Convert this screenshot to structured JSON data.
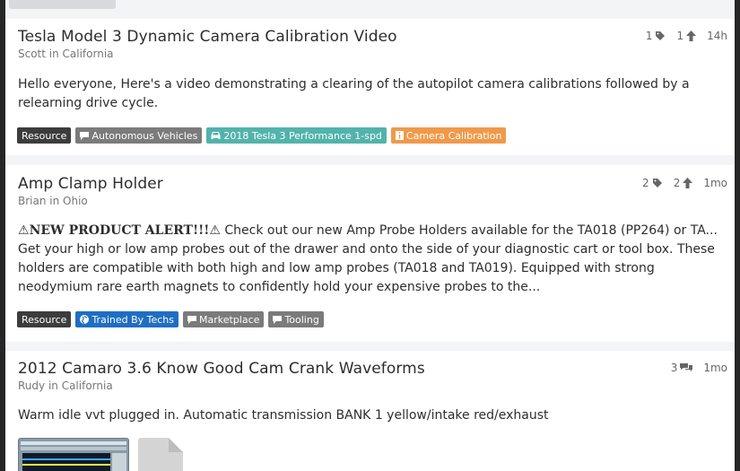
{
  "top_button": {
    "label": ""
  },
  "posts": [
    {
      "title": "Tesla Model 3 Dynamic Camera Calibration Video",
      "author": "Scott in California",
      "meta": {
        "tags_count": "1",
        "votes": "1",
        "age": "14h"
      },
      "body": "Hello everyone, Here's a video demonstrating a clearing of the autopilot camera calibrations followed by a relearning drive cycle.",
      "tags": [
        {
          "label": "Resource",
          "color": "#3c3c3c",
          "icon": ""
        },
        {
          "label": "Autonomous Vehicles",
          "color": "#7b7b7b",
          "icon": "chat-icon"
        },
        {
          "label": "2018 Tesla 3 Performance 1-spd",
          "color": "#52b3ab",
          "icon": "car-icon"
        },
        {
          "label": "Camera Calibration",
          "color": "#f0994a",
          "icon": "info-icon"
        }
      ]
    },
    {
      "title": "Amp Clamp Holder",
      "author": "Brian in Ohio",
      "meta": {
        "tags_count": "2",
        "votes": "2",
        "age": "1mo"
      },
      "body_prefix": "⚠",
      "body_bold": "NEW PRODUCT ALERT!!!",
      "body": "⚠ Check out our new Amp Probe Holders available for the TA018 (PP264) or TA... Get your high or low amp probes out of the drawer and onto the side of your diagnostic cart or tool box. These holders are compatible with both high and low amp probes (TA018 and TA019). Equipped with strong neodymium rare earth magnets to confidently hold your expensive probes to the...",
      "tags": [
        {
          "label": "Resource",
          "color": "#3c3c3c",
          "icon": ""
        },
        {
          "label": "Trained By Techs",
          "color": "#1f6ec2",
          "icon": "globe-icon"
        },
        {
          "label": "Marketplace",
          "color": "#7b7b7b",
          "icon": "chat-icon"
        },
        {
          "label": "Tooling",
          "color": "#7b7b7b",
          "icon": "chat-icon"
        }
      ]
    },
    {
      "title": "2012 Camaro 3.6 Know Good Cam Crank Waveforms",
      "author": "Rudy in California",
      "meta": {
        "comments": "3",
        "age": "1mo"
      },
      "body": "Warm idle vvt plugged in. Automatic transmission BANK 1 yellow/intake red/exhaust"
    }
  ],
  "colors": {
    "card_bg": "#ffffff",
    "page_bg": "#f3f4f6",
    "frame": "#262626"
  }
}
